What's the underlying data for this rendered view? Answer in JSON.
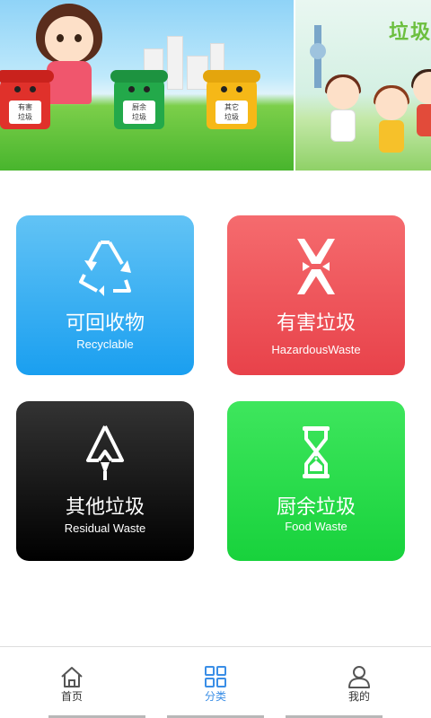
{
  "banner": {
    "bins": [
      {
        "label": "有害\n垃圾"
      },
      {
        "label": "厨余\n垃圾"
      },
      {
        "label": "其它\n垃圾"
      }
    ],
    "right_title": "垃圾"
  },
  "categories": [
    {
      "zh": "可回收物",
      "en": "Recyclable",
      "color": "#1a9ff0"
    },
    {
      "zh": "有害垃圾",
      "en": "HazardousWaste",
      "color": "#e8424a"
    },
    {
      "zh": "其他垃圾",
      "en": "Residual Waste",
      "color": "#000000"
    },
    {
      "zh": "厨余垃圾",
      "en": "Food Waste",
      "color": "#18d23c"
    }
  ],
  "tabbar": {
    "items": [
      {
        "label": "首页",
        "icon": "home-icon"
      },
      {
        "label": "分类",
        "icon": "grid-icon",
        "active": true
      },
      {
        "label": "我的",
        "icon": "user-icon"
      }
    ],
    "active_color": "#3a8ee6"
  }
}
